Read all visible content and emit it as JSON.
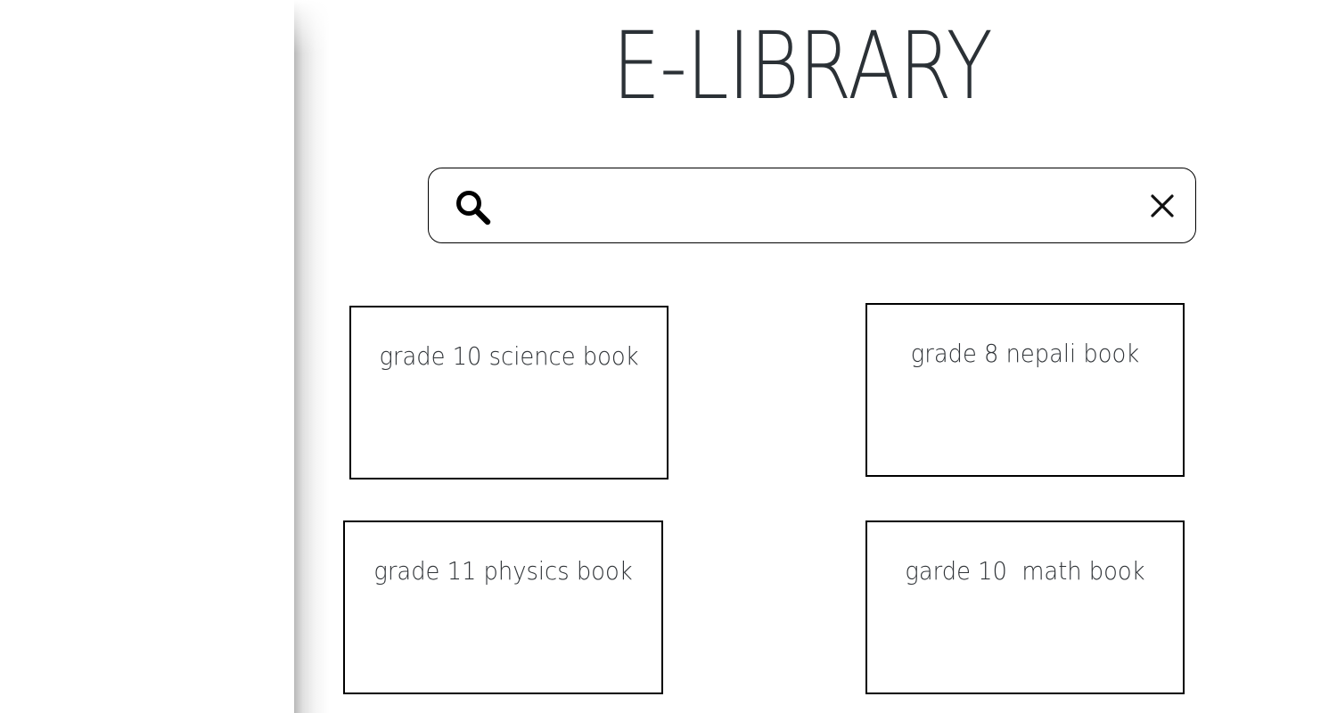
{
  "header": {
    "title": "E-LIBRARY"
  },
  "search": {
    "value": "",
    "placeholder": "",
    "search_icon": "search-icon",
    "clear_icon": "close-icon"
  },
  "books": [
    {
      "label": "grade 10 science book"
    },
    {
      "label": "grade 8 nepali book"
    },
    {
      "label": "grade 11 physics book"
    },
    {
      "label": "garde 10  math book"
    }
  ]
}
